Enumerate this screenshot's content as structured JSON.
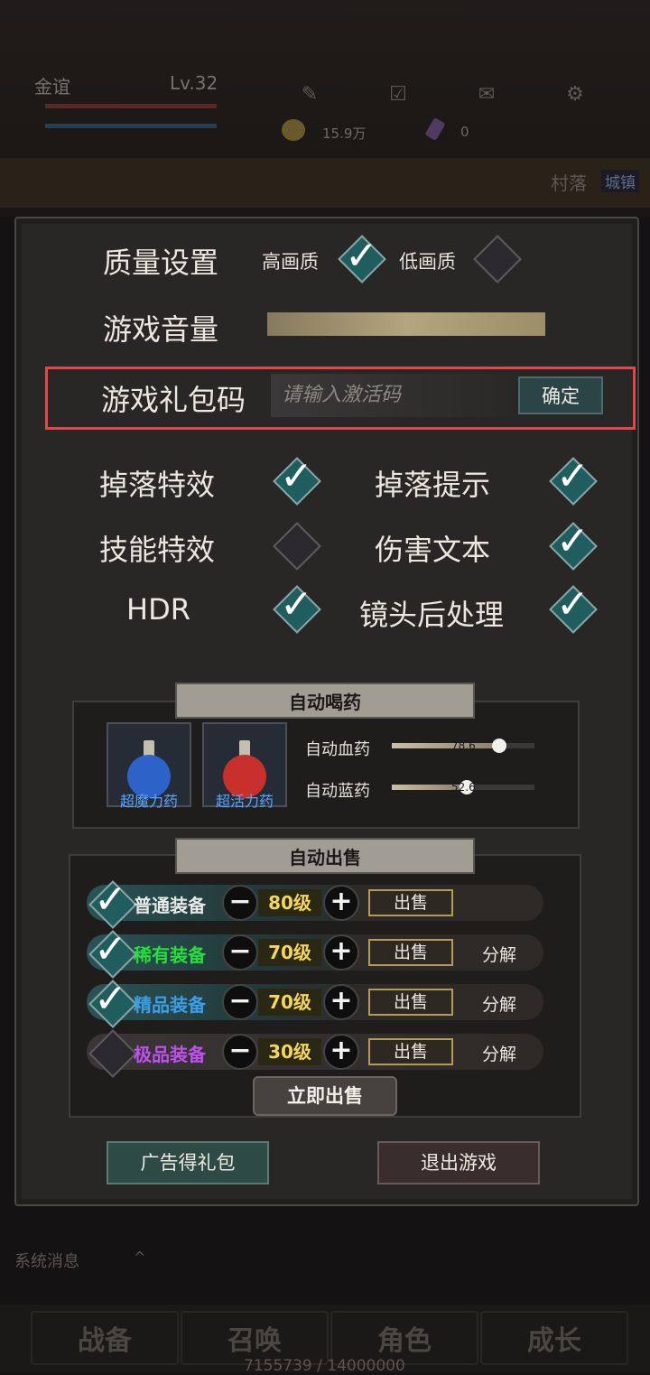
{
  "header": {
    "player_name": "金谊",
    "level": "Lv.32",
    "gold": "15.9万",
    "gems": "0",
    "icons": [
      "quest-scroll-icon",
      "calendar-check-icon",
      "mail-icon",
      "gear-icon"
    ]
  },
  "location": {
    "village": "村落",
    "town": "城镇"
  },
  "settings": {
    "quality_label": "质量设置",
    "quality_high": "高画质",
    "quality_low": "低画质",
    "quality_high_checked": true,
    "quality_low_checked": false,
    "volume_label": "游戏音量",
    "volume_level": 1.0,
    "gift_label": "游戏礼包码",
    "gift_placeholder": "请输入激活码",
    "gift_confirm": "确定",
    "toggles": [
      {
        "label": "掉落特效",
        "checked": true
      },
      {
        "label": "掉落提示",
        "checked": true
      },
      {
        "label": "技能特效",
        "checked": false
      },
      {
        "label": "伤害文本",
        "checked": true
      },
      {
        "label": "HDR",
        "checked": true
      },
      {
        "label": "镜头后处理",
        "checked": true
      }
    ]
  },
  "auto_potion": {
    "title": "自动喝药",
    "potions": [
      {
        "name": "超魔力药",
        "color": "#2d62c8"
      },
      {
        "name": "超活力药",
        "color": "#c8302c"
      }
    ],
    "hp_label": "自动血药",
    "hp_value": "78.6",
    "mp_label": "自动蓝药",
    "mp_value": "52.6"
  },
  "auto_sell": {
    "title": "自动出售",
    "rows": [
      {
        "grade": "普通装备",
        "color": "#e8e8e8",
        "level": "80级",
        "checked": true,
        "sell": "出售",
        "dismantle": ""
      },
      {
        "grade": "稀有装备",
        "color": "#25e03c",
        "level": "70级",
        "checked": true,
        "sell": "出售",
        "dismantle": "分解"
      },
      {
        "grade": "精品装备",
        "color": "#3d9ee8",
        "level": "70级",
        "checked": true,
        "sell": "出售",
        "dismantle": "分解"
      },
      {
        "grade": "极品装备",
        "color": "#c050f0",
        "level": "30级",
        "checked": false,
        "sell": "出售",
        "dismantle": "分解"
      }
    ],
    "sell_now": "立即出售"
  },
  "footer": {
    "ad_gift": "广告得礼包",
    "exit_game": "退出游戏"
  },
  "bottom": {
    "system_message": "系统消息",
    "tabs": [
      "战备",
      "召唤",
      "角色",
      "成长"
    ],
    "exp": "7155739 / 14000000"
  }
}
